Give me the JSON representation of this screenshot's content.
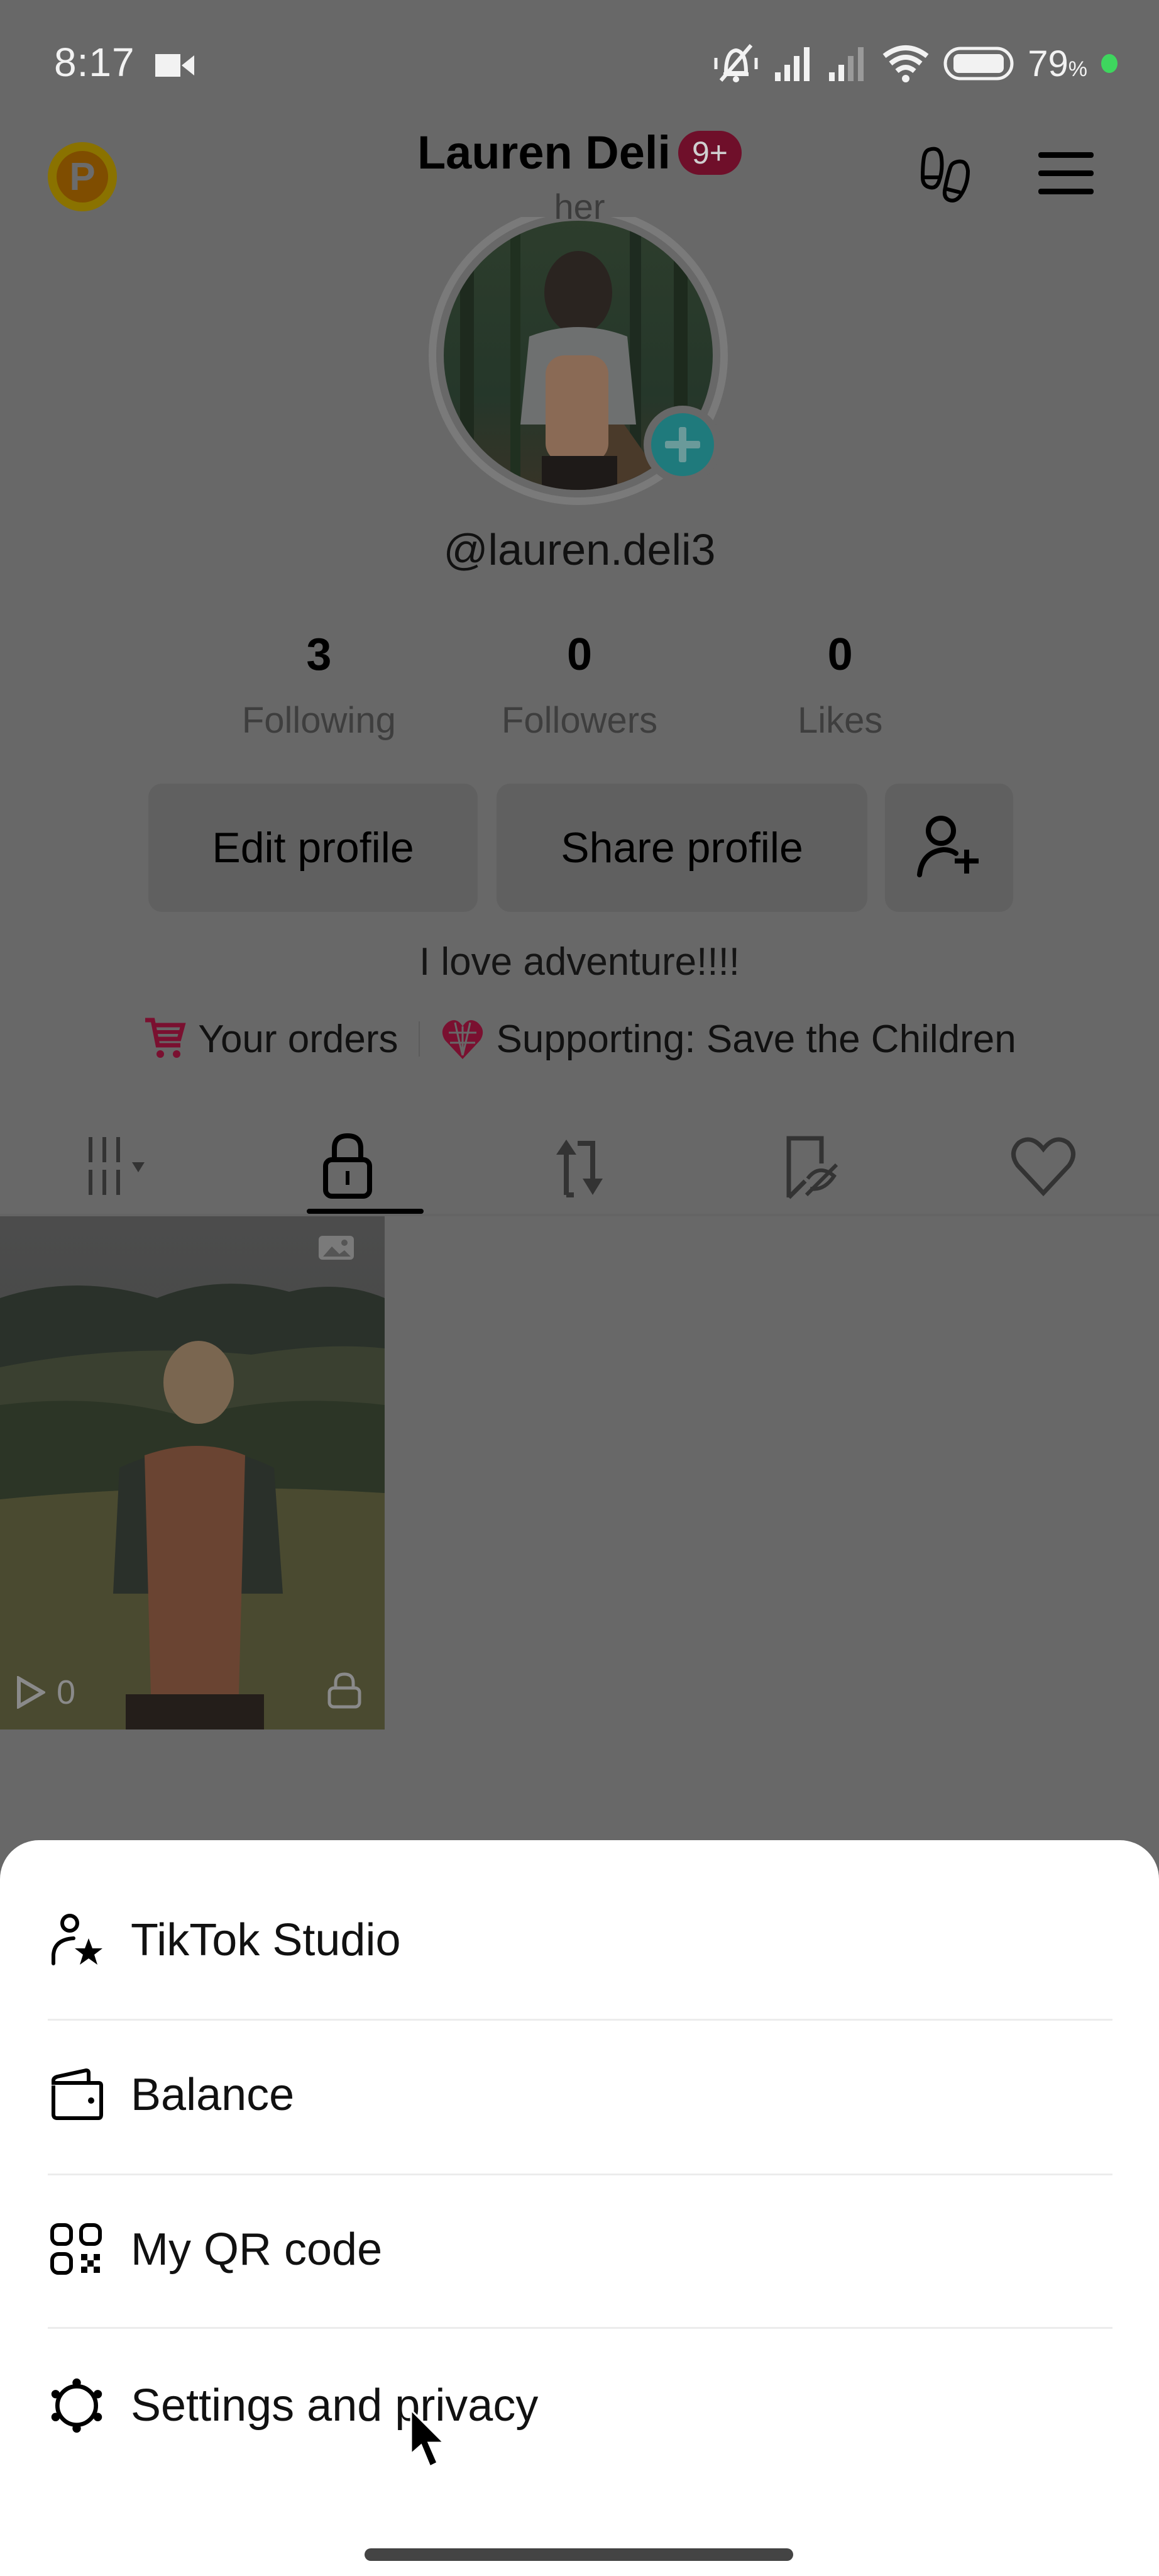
{
  "status_bar": {
    "time": "8:17",
    "battery_percent": "79",
    "battery_unit": "%",
    "icons": [
      "video-recording-icon",
      "bell-muted-icon",
      "signal-sim1-icon",
      "signal-sim2-icon",
      "wifi-icon",
      "battery-icon"
    ]
  },
  "header": {
    "coin_letter": "P",
    "title": "Lauren Deli",
    "notification_badge": "9+",
    "pronoun": "her",
    "right_icons": [
      "footprints-icon",
      "menu-icon"
    ]
  },
  "profile": {
    "handle": "@lauren.deli3",
    "stats": [
      {
        "value": "3",
        "label": "Following"
      },
      {
        "value": "0",
        "label": "Followers"
      },
      {
        "value": "0",
        "label": "Likes"
      }
    ],
    "buttons": {
      "edit": "Edit profile",
      "share": "Share profile"
    },
    "bio": "I love adventure!!!!",
    "links": {
      "orders": "Your orders",
      "supporting": "Supporting: Save the Children"
    }
  },
  "tabs": [
    {
      "name": "videos-grid",
      "active": false
    },
    {
      "name": "private",
      "active": true
    },
    {
      "name": "reposts",
      "active": false
    },
    {
      "name": "favorites-hidden",
      "active": false
    },
    {
      "name": "liked",
      "active": false
    }
  ],
  "posts": [
    {
      "views": "0",
      "type": "photo",
      "private": true
    }
  ],
  "bottom_sheet": {
    "items": [
      {
        "label": "TikTok Studio",
        "icon": "creator-star-icon"
      },
      {
        "label": "Balance",
        "icon": "wallet-icon"
      },
      {
        "label": "My QR code",
        "icon": "qr-code-icon"
      },
      {
        "label": "Settings and privacy",
        "icon": "gear-icon"
      }
    ]
  },
  "colors": {
    "overlay_bg": "#686868",
    "accent_red": "#7a1030",
    "teal_add": "#1f7a7c",
    "badge_bg": "#6f0f2a"
  }
}
